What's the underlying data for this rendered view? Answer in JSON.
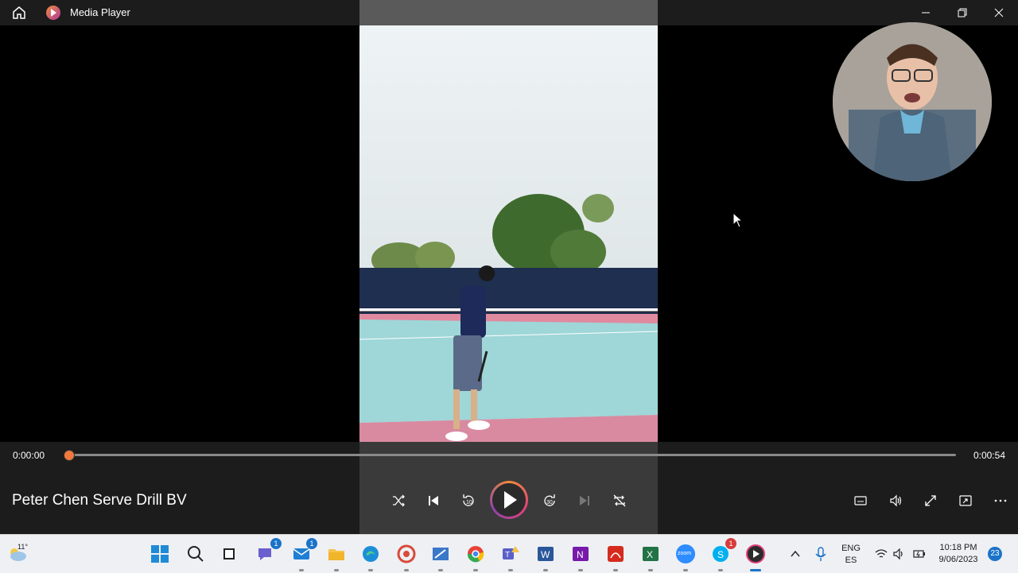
{
  "window": {
    "app_title": "Media Player"
  },
  "player": {
    "current_time": "0:00:00",
    "total_time": "0:00:54",
    "progress": 0,
    "track_title": "Peter Chen Serve Drill BV"
  },
  "taskbar": {
    "weather_temp": "11°",
    "lang_primary": "ENG",
    "lang_secondary": "ES",
    "clock_time": "10:18 PM",
    "clock_date": "9/06/2023",
    "notification_count": "23",
    "teams_badge": "1",
    "mail_badge": "1",
    "skype_badge": "1",
    "zoom_label": "zoom"
  },
  "colors": {
    "accent": "#f07a3e",
    "bg": "#1c1c1c",
    "taskbar": "#eef0f4"
  }
}
